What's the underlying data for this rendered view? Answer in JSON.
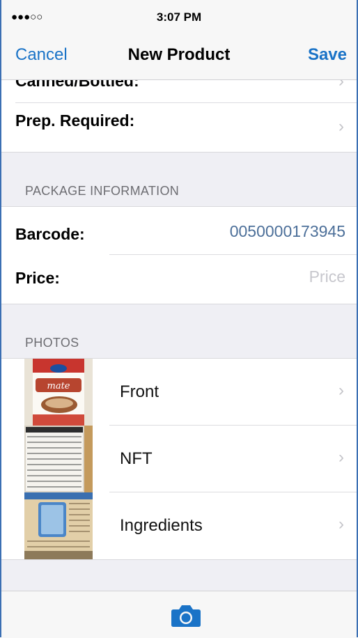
{
  "status_bar": {
    "signal": "●●●○○",
    "time": "3:07 PM"
  },
  "nav": {
    "cancel": "Cancel",
    "title": "New Product",
    "save": "Save"
  },
  "rows": {
    "partial_label": "Canned/Bottled:",
    "prep_required": "Prep. Required:"
  },
  "package": {
    "header": "PACKAGE INFORMATION",
    "barcode_label": "Barcode:",
    "barcode_value": "0050000173945",
    "price_label": "Price:",
    "price_placeholder": "Price"
  },
  "photos": {
    "header": "PHOTOS",
    "items": [
      {
        "label": "Front",
        "image": "coffee-mate-front-photo"
      },
      {
        "label": "NFT",
        "image": "nutrition-facts-table-photo"
      },
      {
        "label": "Ingredients",
        "image": "ingredients-list-photo"
      }
    ]
  },
  "toolbar": {
    "camera_icon": "camera-icon"
  },
  "colors": {
    "accent": "#1a73c7",
    "value_text": "#4c6f99",
    "group_bg": "#efeff4"
  }
}
